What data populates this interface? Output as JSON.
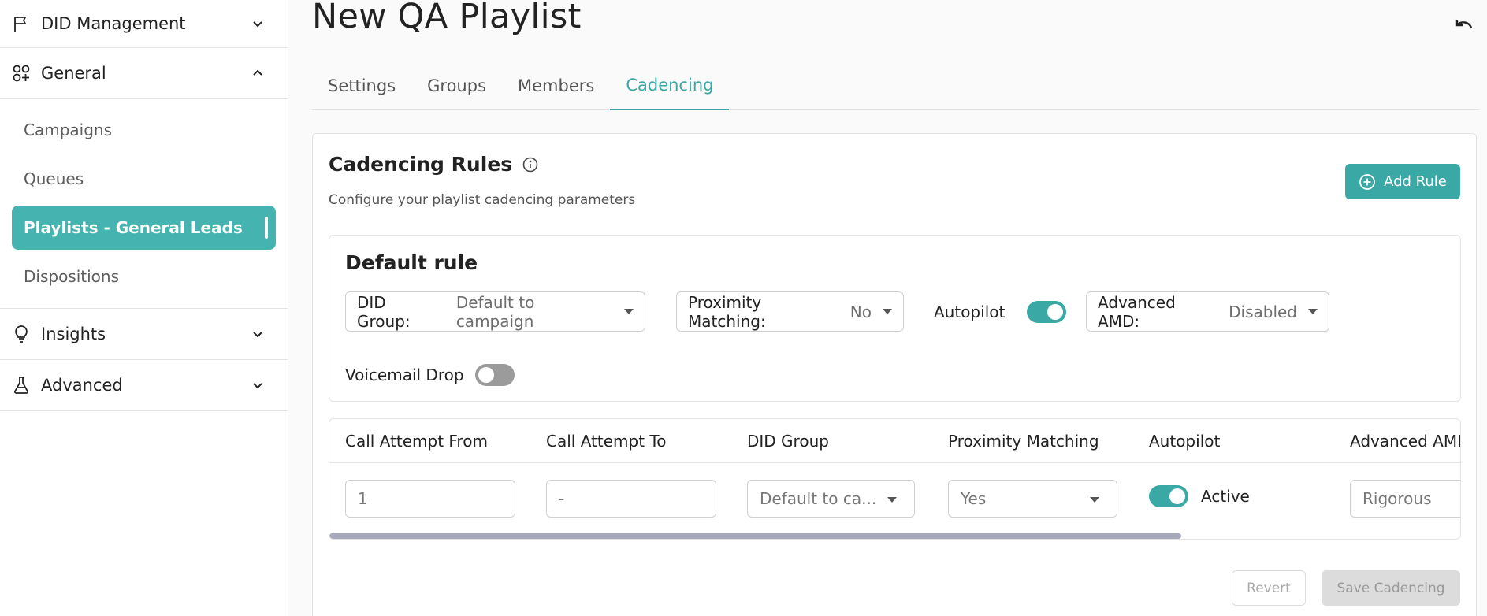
{
  "sidebar": {
    "sections": {
      "did_management": {
        "label": "DID Management",
        "icon": "flag-icon"
      },
      "general": {
        "label": "General",
        "icon": "shapes-icon"
      },
      "insights": {
        "label": "Insights",
        "icon": "lightbulb-icon"
      },
      "advanced": {
        "label": "Advanced",
        "icon": "flask-icon"
      }
    },
    "general_items": [
      {
        "label": "Campaigns"
      },
      {
        "label": "Queues"
      },
      {
        "label": "Playlists - General Leads",
        "active": true
      },
      {
        "label": "Dispositions"
      }
    ]
  },
  "page": {
    "title": "New QA Playlist"
  },
  "tabs": [
    {
      "label": "Settings"
    },
    {
      "label": "Groups"
    },
    {
      "label": "Members"
    },
    {
      "label": "Cadencing",
      "active": true
    }
  ],
  "cadencing": {
    "title": "Cadencing Rules",
    "subtitle": "Configure your playlist cadencing parameters",
    "add_rule_label": "Add Rule",
    "default_rule": {
      "title": "Default rule",
      "did_group": {
        "label": "DID Group:",
        "value": "Default to campaign"
      },
      "proximity": {
        "label": "Proximity Matching:",
        "value": "No"
      },
      "autopilot": {
        "label": "Autopilot",
        "on": true
      },
      "advanced_amd": {
        "label": "Advanced AMD:",
        "value": "Disabled"
      },
      "voicemail_drop": {
        "label": "Voicemail Drop",
        "on": false
      }
    },
    "table": {
      "headers": [
        "Call Attempt From",
        "Call Attempt To",
        "DID Group",
        "Proximity Matching",
        "Autopilot",
        "Advanced AMD"
      ],
      "row": {
        "from": "1",
        "to": "-",
        "did_group": "Default to ca...",
        "proximity": "Yes",
        "autopilot": "Active",
        "advanced_amd": "Rigorous"
      }
    },
    "buttons": {
      "revert": "Revert",
      "save": "Save Cadencing"
    }
  },
  "colors": {
    "accent": "#3aa9a5",
    "active_nav": "#45b4b0"
  }
}
